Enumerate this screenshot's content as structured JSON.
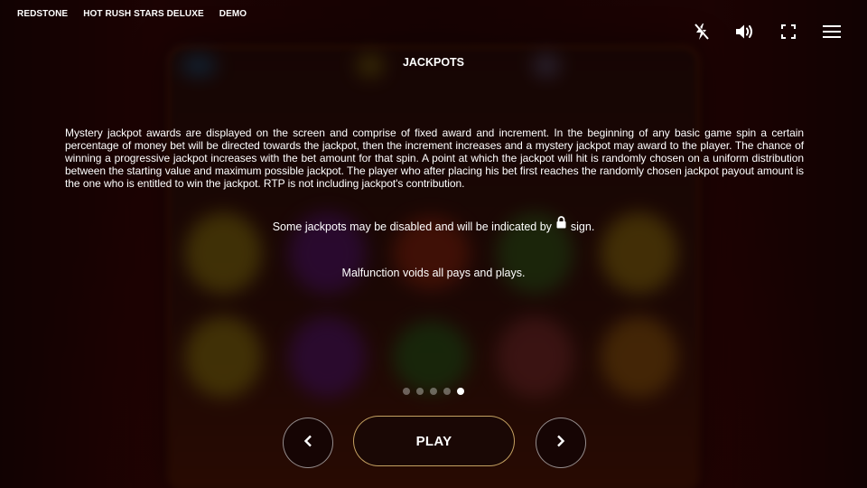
{
  "topbar": {
    "items": [
      "REDSTONE",
      "HOT RUSH STARS DELUXE",
      "DEMO"
    ],
    "icons": [
      "turbo-off-icon",
      "volume-icon",
      "fullscreen-icon",
      "menu-icon"
    ]
  },
  "panel": {
    "title": "JACKPOTS",
    "body": "Mystery jackpot awards are displayed on the screen and comprise of fixed award and increment. In the beginning of any basic game spin a certain percentage of money bet will be directed towards the jackpot, then the increment increases and a mystery jackpot may award to the player. The chance of winning a progressive jackpot increases with the bet amount for that spin. A point at which the jackpot will hit is randomly chosen on a uniform distribution between the starting value and maximum possible jackpot. The player who after placing his bet first reaches the randomly chosen jackpot payout amount is the one who is entitled to win the jackpot. RTP is not including jackpot's contribution.",
    "lock_text_before": "Some jackpots may be disabled and will be indicated by",
    "lock_text_after": "sign.",
    "malfunction": "Malfunction voids all pays and plays."
  },
  "pagination": {
    "total": 5,
    "active": 5
  },
  "controls": {
    "play_label": "PLAY",
    "prev_icon": "chevron-left-icon",
    "next_icon": "chevron-right-icon"
  }
}
